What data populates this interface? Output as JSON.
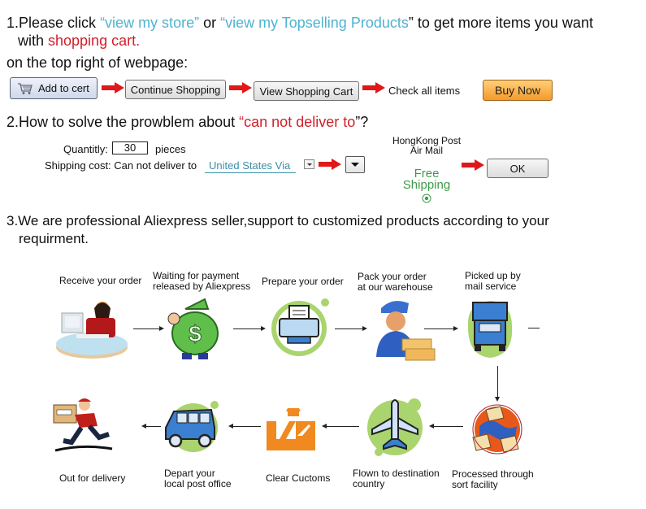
{
  "section1": {
    "line1_prefix": "1.Please click ",
    "link1": "“view my store”",
    "mid": " or ",
    "link2": "“view my Topselling Products",
    "line1_suffix": "” to get more items you want",
    "line2_prefix": "with ",
    "line2_red": "shopping cart.",
    "line3": "on the top right of webpage:",
    "steps": {
      "add_to_cart": "Add to cert",
      "continue_shopping": "Continue Shopping",
      "view_cart": "View Shopping Cart",
      "check_items": "Check all items",
      "buy_now": "Buy Now"
    }
  },
  "section2": {
    "title_prefix": "2.How to solve the prowblem about ",
    "title_red": "“can not deliver to",
    "title_suffix": "”?",
    "quantity_label": "Quantitly:",
    "quantity_value": "30",
    "quantity_unit": "pieces",
    "shipping_label": "Shipping cost: Can not deliver to",
    "shipping_link": "United States Via",
    "carrier_line1": "HongKong Post",
    "carrier_line2": "Air Mail",
    "free_line1": "Free",
    "free_line2": "Shipping",
    "ok_label": "OK",
    "colors": {
      "free_shipping": "#3f9a4a",
      "link": "#3a8fa6"
    }
  },
  "section3": {
    "line1": "3.We are professional Aliexpress seller,support to customized products according to your",
    "line2": "requirment."
  },
  "flow": {
    "top_row": [
      {
        "label": "Receive your order",
        "icon": "computer-operator-icon"
      },
      {
        "label_line1": "Waiting for payment",
        "label_line2": "released by Aliexpress",
        "icon": "money-bag-icon"
      },
      {
        "label": "Prepare your order",
        "icon": "printer-icon"
      },
      {
        "label_line1": "Pack your order",
        "label_line2": "at our warehouse",
        "icon": "warehouse-worker-icon"
      },
      {
        "label_line1": "Picked up by",
        "label_line2": "mail service",
        "icon": "truck-icon"
      }
    ],
    "bottom_row": [
      {
        "label": "Out for delivery",
        "icon": "courier-running-icon"
      },
      {
        "label_line1": "Depart your",
        "label_line2": "local post office",
        "icon": "van-icon"
      },
      {
        "label": "Clear Cuctoms",
        "icon": "customs-officer-icon"
      },
      {
        "label_line1": "Flown to destination",
        "label_line2": "country",
        "icon": "airplane-icon"
      },
      {
        "label_line1": "Processed through",
        "label_line2": "sort facility",
        "icon": "globe-mail-icon"
      }
    ]
  },
  "colors": {
    "link_blue": "#4fb3cf",
    "emphasis_red": "#d0202a",
    "arrow_red": "#e01818",
    "buy_now_orange": "#f6a83a",
    "icon_green": "#a9d46e"
  }
}
